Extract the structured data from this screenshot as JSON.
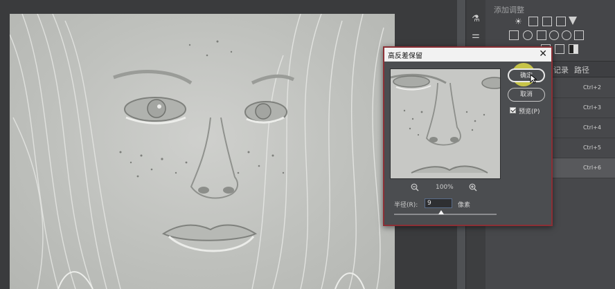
{
  "dialog": {
    "title": "高反差保留",
    "close_glyph": "✕",
    "ok_label": "确定",
    "cancel_label": "取消",
    "preview_label": "预览(P)",
    "preview_checked": true,
    "zoom_level": "100%",
    "radius_label": "半径(R):",
    "radius_value": "9",
    "radius_unit": "像素"
  },
  "adjust_panel": {
    "title": "添加调整"
  },
  "layers_panel": {
    "tabs": [
      "记录",
      "路径"
    ],
    "rows": [
      {
        "shortcut": "Ctrl+2",
        "active": false
      },
      {
        "shortcut": "Ctrl+3",
        "active": false
      },
      {
        "shortcut": "Ctrl+4",
        "active": false
      },
      {
        "shortcut": "Ctrl+5",
        "active": false
      },
      {
        "shortcut": "Ctrl+6",
        "active": true
      }
    ]
  },
  "icons": {
    "zoom_out": "zoom-out-icon",
    "zoom_in": "zoom-in-icon",
    "close": "close-icon",
    "cursor": "cursor-arrow-icon"
  },
  "colors": {
    "dialog_border": "#8c2f35",
    "highlight": "#ebe646",
    "panel_bg": "#47484b"
  }
}
